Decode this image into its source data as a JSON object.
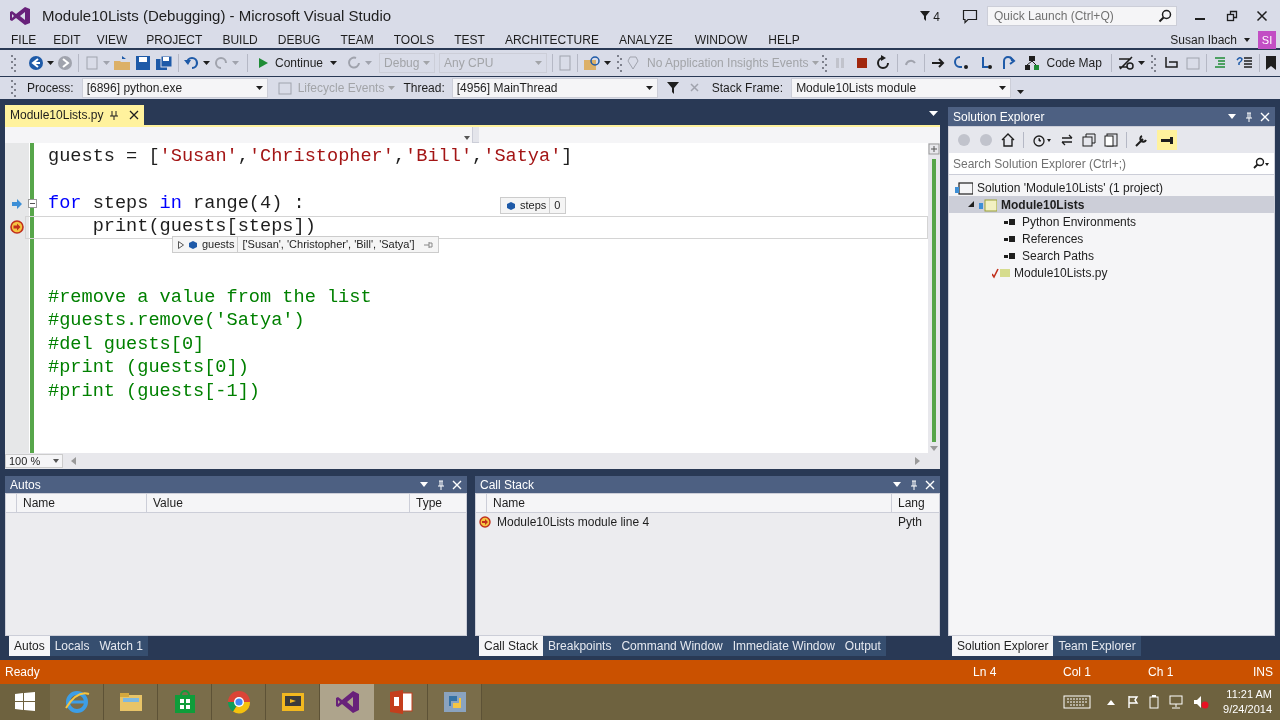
{
  "window": {
    "title": "Module10Lists (Debugging) - Microsoft Visual Studio",
    "notifications": "4",
    "quick_launch": {
      "placeholder": "Quick Launch (Ctrl+Q)"
    }
  },
  "menu": [
    "FILE",
    "EDIT",
    "VIEW",
    "PROJECT",
    "BUILD",
    "DEBUG",
    "TEAM",
    "TOOLS",
    "TEST",
    "ARCHITECTURE",
    "ANALYZE",
    "WINDOW",
    "HELP"
  ],
  "user": {
    "name": "Susan Ibach",
    "initials": "SI"
  },
  "toolbar": {
    "continue": "Continue",
    "configuration": "Debug",
    "platform": "Any CPU",
    "insights": "No Application Insights Events",
    "code_map": "Code Map"
  },
  "debug_location": {
    "process_label": "Process:",
    "process": "[6896] python.exe",
    "lifecycle": "Lifecycle Events",
    "thread_label": "Thread:",
    "thread": "[4956] MainThread",
    "stack_frame_label": "Stack Frame:",
    "stack_frame": "Module10Lists module"
  },
  "document_tab": {
    "title": "Module10Lists.py",
    "selected": true
  },
  "code": [
    {
      "step_arrow": false,
      "current": false,
      "fold": false,
      "tokens": [
        {
          "kind": "plain",
          "text": "guests = ["
        },
        {
          "kind": "string",
          "text": "'Susan'"
        },
        {
          "kind": "plain",
          "text": ","
        },
        {
          "kind": "string",
          "text": "'Christopher'"
        },
        {
          "kind": "plain",
          "text": ","
        },
        {
          "kind": "string",
          "text": "'Bill'"
        },
        {
          "kind": "plain",
          "text": ","
        },
        {
          "kind": "string",
          "text": "'Satya'"
        },
        {
          "kind": "plain",
          "text": "]"
        }
      ]
    },
    {
      "step_arrow": false,
      "current": false,
      "fold": false
    },
    {
      "step_arrow": true,
      "current": false,
      "fold": true,
      "tokens": [
        {
          "kind": "keyword",
          "text": "for"
        },
        {
          "kind": "plain",
          "text": " steps "
        },
        {
          "kind": "keyword",
          "text": "in"
        },
        {
          "kind": "plain",
          "text": " range(4) :"
        }
      ]
    },
    {
      "step_arrow": false,
      "current": true,
      "fold": false,
      "tokens": [
        {
          "kind": "plain",
          "text": "    print(guests[steps])"
        }
      ]
    },
    {
      "step_arrow": false,
      "current": false,
      "fold": false
    },
    {
      "step_arrow": false,
      "current": false,
      "fold": false
    },
    {
      "step_arrow": false,
      "current": false,
      "fold": false,
      "tokens": [
        {
          "kind": "comment",
          "text": "#remove a value from the list"
        }
      ]
    },
    {
      "step_arrow": false,
      "current": false,
      "fold": false,
      "tokens": [
        {
          "kind": "comment",
          "text": "#guests.remove('Satya')"
        }
      ]
    },
    {
      "step_arrow": false,
      "current": false,
      "fold": false,
      "tokens": [
        {
          "kind": "comment",
          "text": "#del guests[0]"
        }
      ]
    },
    {
      "step_arrow": false,
      "current": false,
      "fold": false,
      "tokens": [
        {
          "kind": "comment",
          "text": "#print (guests[0])"
        }
      ]
    },
    {
      "step_arrow": false,
      "current": false,
      "fold": false,
      "tokens": [
        {
          "kind": "comment",
          "text": "#print (guests[-1])"
        }
      ]
    }
  ],
  "datatips": [
    {
      "name": "steps",
      "value": "0",
      "expandable": false
    },
    {
      "name": "guests",
      "value": "['Susan', 'Christopher', 'Bill', 'Satya']",
      "expandable": true
    }
  ],
  "zoom": "100 %",
  "autos": {
    "title": "Autos",
    "columns": [
      "Name",
      "Value",
      "Type"
    ],
    "tabs": [
      {
        "label": "Autos",
        "selected": true
      },
      {
        "label": "Locals",
        "selected": false
      },
      {
        "label": "Watch 1",
        "selected": false
      }
    ]
  },
  "call_stack": {
    "title": "Call Stack",
    "columns": [
      "Name",
      "Lang"
    ],
    "rows": [
      {
        "name": "Module10Lists module line 4",
        "language": "Pyth",
        "current": true
      }
    ],
    "tabs": [
      {
        "label": "Call Stack",
        "selected": true
      },
      {
        "label": "Breakpoints",
        "selected": false
      },
      {
        "label": "Command Window",
        "selected": false
      },
      {
        "label": "Immediate Window",
        "selected": false
      },
      {
        "label": "Output",
        "selected": false
      }
    ]
  },
  "solution_explorer": {
    "title": "Solution Explorer",
    "search": {
      "placeholder": "Search Solution Explorer (Ctrl+;)"
    },
    "tree": [
      {
        "kind": "solution",
        "label": "Solution 'Module10Lists' (1 project)",
        "selected": false,
        "children": [
          {
            "kind": "project",
            "label": "Module10Lists",
            "selected": true,
            "expanded": true,
            "children": [
              {
                "kind": "folder",
                "label": "Python Environments",
                "selected": false
              },
              {
                "kind": "folder",
                "label": "References",
                "selected": false
              },
              {
                "kind": "folder",
                "label": "Search Paths",
                "selected": false
              },
              {
                "kind": "file",
                "label": "Module10Lists.py",
                "selected": false
              }
            ]
          }
        ]
      }
    ],
    "tabs": [
      {
        "label": "Solution Explorer",
        "selected": true
      },
      {
        "label": "Team Explorer",
        "selected": false
      }
    ]
  },
  "status_bar": {
    "message": "Ready",
    "line": "Ln 4",
    "column": "Col 1",
    "char": "Ch 1",
    "mode": "INS"
  },
  "taskbar": {
    "apps": [
      {
        "kind": "ie",
        "selected": false
      },
      {
        "kind": "folder",
        "selected": false
      },
      {
        "kind": "store",
        "selected": false
      },
      {
        "kind": "chrome",
        "selected": false
      },
      {
        "kind": "media",
        "selected": false
      },
      {
        "kind": "vs",
        "selected": true
      },
      {
        "kind": "powerpoint",
        "selected": false
      },
      {
        "kind": "python",
        "selected": false
      }
    ],
    "time": "11:21 AM",
    "date": "9/24/2014"
  }
}
